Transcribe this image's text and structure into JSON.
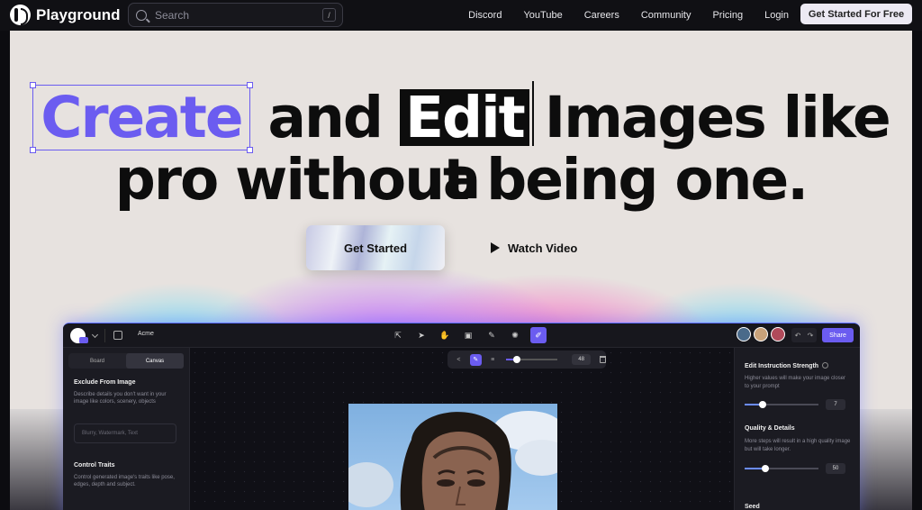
{
  "nav": {
    "brand": "Playground",
    "search_placeholder": "Search",
    "search_shortcut": "/",
    "links": [
      "Discord",
      "YouTube",
      "Careers",
      "Community",
      "Pricing",
      "Login"
    ],
    "cta": "Get Started For Free"
  },
  "hero": {
    "word_create": "Create",
    "word_and": "and",
    "word_edit": "Edit",
    "line1_rest": "Images like a",
    "line2": "pro without being one.",
    "primary_button": "Get Started",
    "secondary_button": "Watch Video"
  },
  "app": {
    "project_name": "Acme",
    "share_label": "Share",
    "left_panel": {
      "tabs": [
        "Board",
        "Canvas"
      ],
      "active_tab": "Canvas",
      "exclude_title": "Exclude From Image",
      "exclude_desc": "Describe details you don't want in your image like colors, scenery, objects",
      "exclude_placeholder": "Blurry, Watermark, Text",
      "control_title": "Control Traits",
      "control_desc": "Control generated image's traits like pose, edges, depth and subject."
    },
    "brush": {
      "size_value": "48",
      "size_fraction": 0.2
    },
    "right_panel": {
      "strength_title": "Edit Instruction Strength",
      "strength_desc": "Higher values will make your image closer to your prompt",
      "strength_value": "7",
      "strength_fraction": 0.24,
      "quality_title": "Quality & Details",
      "quality_desc": "More steps will result in a high quality image but will take longer.",
      "quality_value": "50",
      "quality_fraction": 0.28,
      "seed_title": "Seed"
    }
  },
  "colors": {
    "accent": "#6b5cf0",
    "hero_bg": "#e7e2df",
    "nav_bg": "#101014"
  }
}
